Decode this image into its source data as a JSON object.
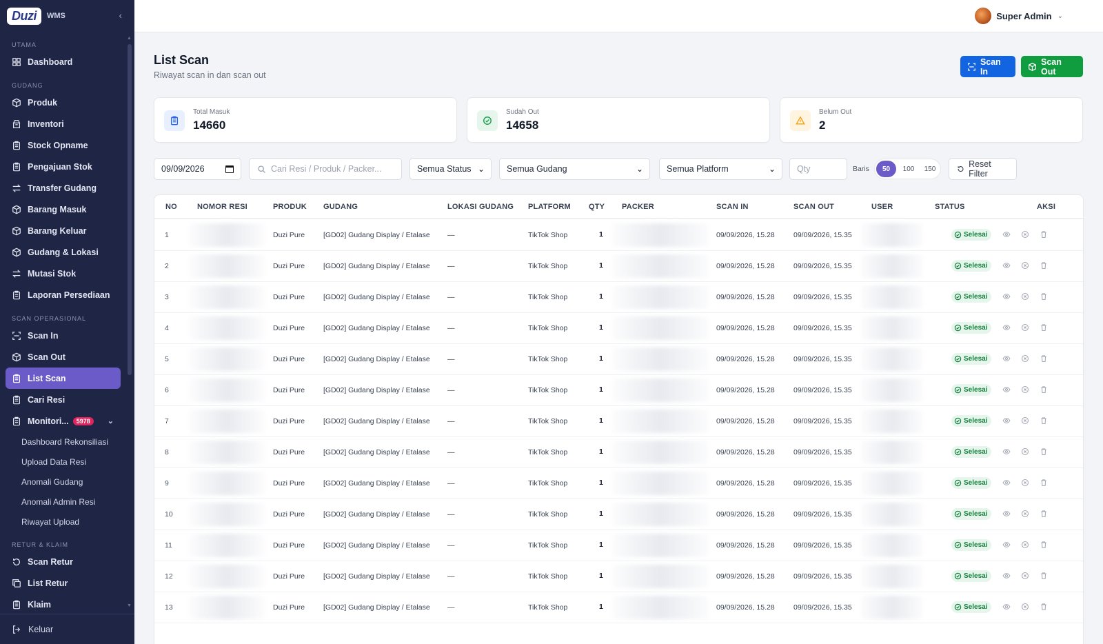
{
  "brand": {
    "logo": "Duzi",
    "sub": "WMS"
  },
  "sidebar": {
    "sections": [
      {
        "title": "UTAMA",
        "items": [
          {
            "label": "Dashboard",
            "icon": "grid-icon"
          }
        ]
      },
      {
        "title": "GUDANG",
        "items": [
          {
            "label": "Produk",
            "icon": "box-icon"
          },
          {
            "label": "Inventori",
            "icon": "boxes-icon"
          },
          {
            "label": "Stock Opname",
            "icon": "clipboard-icon"
          },
          {
            "label": "Pengajuan Stok",
            "icon": "clipboard-icon"
          },
          {
            "label": "Transfer Gudang",
            "icon": "transfer-icon"
          },
          {
            "label": "Barang Masuk",
            "icon": "box-icon"
          },
          {
            "label": "Barang Keluar",
            "icon": "box-icon"
          },
          {
            "label": "Gudang & Lokasi",
            "icon": "box-icon"
          },
          {
            "label": "Mutasi Stok",
            "icon": "transfer-icon"
          },
          {
            "label": "Laporan Persediaan",
            "icon": "clipboard-icon"
          }
        ]
      },
      {
        "title": "SCAN OPERASIONAL",
        "items": [
          {
            "label": "Scan In",
            "icon": "scan-icon"
          },
          {
            "label": "Scan Out",
            "icon": "box-icon"
          },
          {
            "label": "List Scan",
            "icon": "clipboard-icon",
            "active": true
          },
          {
            "label": "Cari Resi",
            "icon": "clipboard-icon"
          },
          {
            "label": "Monitori...",
            "icon": "clipboard-icon",
            "badge": "5978",
            "expanded": true
          }
        ]
      },
      {
        "title": "RETUR & KLAIM",
        "items": [
          {
            "label": "Scan Retur",
            "icon": "refresh-icon"
          },
          {
            "label": "List Retur",
            "icon": "copy-icon"
          },
          {
            "label": "Klaim",
            "icon": "clipboard-icon"
          }
        ]
      }
    ],
    "monitoring_sub": [
      "Dashboard Rekonsiliasi",
      "Upload Data Resi",
      "Anomali Gudang",
      "Anomali Admin Resi",
      "Riwayat Upload"
    ],
    "logout": "Keluar"
  },
  "topbar": {
    "user_name": "Super Admin"
  },
  "page": {
    "title": "List Scan",
    "subtitle": "Riwayat scan in dan scan out"
  },
  "actions": {
    "scan_in": "Scan In",
    "scan_out": "Scan Out"
  },
  "stats": {
    "total_masuk": {
      "label": "Total Masuk",
      "value": "14660"
    },
    "sudah_out": {
      "label": "Sudah Out",
      "value": "14658"
    },
    "belum_out": {
      "label": "Belum Out",
      "value": "2"
    }
  },
  "filters": {
    "date": "09/09/2026",
    "search_placeholder": "Cari Resi / Produk / Packer...",
    "status": "Semua Status",
    "gudang": "Semua Gudang",
    "platform": "Semua Platform",
    "qty_placeholder": "Qty",
    "baris_label": "Baris",
    "baris_options": [
      "50",
      "100",
      "150"
    ],
    "baris_selected": "50",
    "reset": "Reset Filter"
  },
  "table": {
    "columns": [
      "NO",
      "NOMOR RESI",
      "PRODUK",
      "GUDANG",
      "LOKASI GUDANG",
      "PLATFORM",
      "QTY",
      "PACKER",
      "SCAN IN",
      "SCAN OUT",
      "USER",
      "STATUS",
      "AKSI"
    ],
    "rows": [
      {
        "no": "1",
        "produk": "Duzi Pure",
        "gudang": "[GD02] Gudang Display / Etalase",
        "lokasi": "—",
        "platform": "TikTok Shop",
        "qty": "1",
        "scan_in": "09/09/2026, 15.28",
        "scan_out": "09/09/2026, 15.35",
        "status": "Selesai"
      },
      {
        "no": "2",
        "produk": "Duzi Pure",
        "gudang": "[GD02] Gudang Display / Etalase",
        "lokasi": "—",
        "platform": "TikTok Shop",
        "qty": "1",
        "scan_in": "09/09/2026, 15.28",
        "scan_out": "09/09/2026, 15.35",
        "status": "Selesai"
      },
      {
        "no": "3",
        "produk": "Duzi Pure",
        "gudang": "[GD02] Gudang Display / Etalase",
        "lokasi": "—",
        "platform": "TikTok Shop",
        "qty": "1",
        "scan_in": "09/09/2026, 15.28",
        "scan_out": "09/09/2026, 15.35",
        "status": "Selesai"
      },
      {
        "no": "4",
        "produk": "Duzi Pure",
        "gudang": "[GD02] Gudang Display / Etalase",
        "lokasi": "—",
        "platform": "TikTok Shop",
        "qty": "1",
        "scan_in": "09/09/2026, 15.28",
        "scan_out": "09/09/2026, 15.35",
        "status": "Selesai"
      },
      {
        "no": "5",
        "produk": "Duzi Pure",
        "gudang": "[GD02] Gudang Display / Etalase",
        "lokasi": "—",
        "platform": "TikTok Shop",
        "qty": "1",
        "scan_in": "09/09/2026, 15.28",
        "scan_out": "09/09/2026, 15.35",
        "status": "Selesai"
      },
      {
        "no": "6",
        "produk": "Duzi Pure",
        "gudang": "[GD02] Gudang Display / Etalase",
        "lokasi": "—",
        "platform": "TikTok Shop",
        "qty": "1",
        "scan_in": "09/09/2026, 15.28",
        "scan_out": "09/09/2026, 15.35",
        "status": "Selesai"
      },
      {
        "no": "7",
        "produk": "Duzi Pure",
        "gudang": "[GD02] Gudang Display / Etalase",
        "lokasi": "—",
        "platform": "TikTok Shop",
        "qty": "1",
        "scan_in": "09/09/2026, 15.28",
        "scan_out": "09/09/2026, 15.35",
        "status": "Selesai"
      },
      {
        "no": "8",
        "produk": "Duzi Pure",
        "gudang": "[GD02] Gudang Display / Etalase",
        "lokasi": "—",
        "platform": "TikTok Shop",
        "qty": "1",
        "scan_in": "09/09/2026, 15.28",
        "scan_out": "09/09/2026, 15.35",
        "status": "Selesai"
      },
      {
        "no": "9",
        "produk": "Duzi Pure",
        "gudang": "[GD02] Gudang Display / Etalase",
        "lokasi": "—",
        "platform": "TikTok Shop",
        "qty": "1",
        "scan_in": "09/09/2026, 15.28",
        "scan_out": "09/09/2026, 15.35",
        "status": "Selesai"
      },
      {
        "no": "10",
        "produk": "Duzi Pure",
        "gudang": "[GD02] Gudang Display / Etalase",
        "lokasi": "—",
        "platform": "TikTok Shop",
        "qty": "1",
        "scan_in": "09/09/2026, 15.28",
        "scan_out": "09/09/2026, 15.35",
        "status": "Selesai"
      },
      {
        "no": "11",
        "produk": "Duzi Pure",
        "gudang": "[GD02] Gudang Display / Etalase",
        "lokasi": "—",
        "platform": "TikTok Shop",
        "qty": "1",
        "scan_in": "09/09/2026, 15.28",
        "scan_out": "09/09/2026, 15.35",
        "status": "Selesai"
      },
      {
        "no": "12",
        "produk": "Duzi Pure",
        "gudang": "[GD02] Gudang Display / Etalase",
        "lokasi": "—",
        "platform": "TikTok Shop",
        "qty": "1",
        "scan_in": "09/09/2026, 15.28",
        "scan_out": "09/09/2026, 15.35",
        "status": "Selesai"
      },
      {
        "no": "13",
        "produk": "Duzi Pure",
        "gudang": "[GD02] Gudang Display / Etalase",
        "lokasi": "—",
        "platform": "TikTok Shop",
        "qty": "1",
        "scan_in": "09/09/2026, 15.28",
        "scan_out": "09/09/2026, 15.35",
        "status": "Selesai"
      }
    ]
  },
  "colors": {
    "sidebar": "#1f2544",
    "active": "#6b5bc8",
    "scan_in_button": "#1264e0",
    "scan_out_button": "#0f9d3f",
    "badge": "#e0245e",
    "status_ok": "#15803d"
  }
}
